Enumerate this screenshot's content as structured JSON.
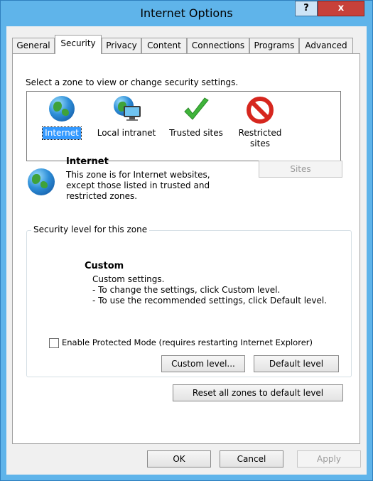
{
  "window": {
    "title": "Internet Options",
    "help_label": "?",
    "close_label": "x"
  },
  "tabs": [
    {
      "label": "General"
    },
    {
      "label": "Security"
    },
    {
      "label": "Privacy"
    },
    {
      "label": "Content"
    },
    {
      "label": "Connections"
    },
    {
      "label": "Programs"
    },
    {
      "label": "Advanced"
    }
  ],
  "security": {
    "zone_prompt": "Select a zone to view or change security settings.",
    "zones": [
      {
        "label": "Internet",
        "icon": "globe-icon",
        "selected": true
      },
      {
        "label": "Local intranet",
        "icon": "intranet-icon",
        "selected": false
      },
      {
        "label": "Trusted sites",
        "icon": "checkmark-icon",
        "selected": false
      },
      {
        "label": "Restricted sites",
        "label_line1": "Restricted",
        "label_line2": "sites",
        "icon": "restricted-icon",
        "selected": false
      }
    ],
    "zone_info": {
      "title": "Internet",
      "description_lines": [
        "This zone is for Internet websites,",
        "except those listed in trusted and",
        "restricted zones."
      ],
      "sites_button": "Sites"
    },
    "level_group": {
      "label": "Security level for this zone",
      "level_name": "Custom",
      "lines": [
        "Custom settings.",
        "- To change the settings, click Custom level.",
        "- To use the recommended settings, click Default level."
      ],
      "protected_mode_label": "Enable Protected Mode (requires restarting Internet Explorer)",
      "protected_mode_checked": false,
      "custom_level_button": "Custom level...",
      "default_level_button": "Default level"
    },
    "reset_button": "Reset all zones to default level"
  },
  "footer": {
    "ok": "OK",
    "cancel": "Cancel",
    "apply": "Apply"
  },
  "colors": {
    "frame": "#5fb4ea",
    "selection": "#3399ff",
    "close_button": "#c7413a"
  }
}
